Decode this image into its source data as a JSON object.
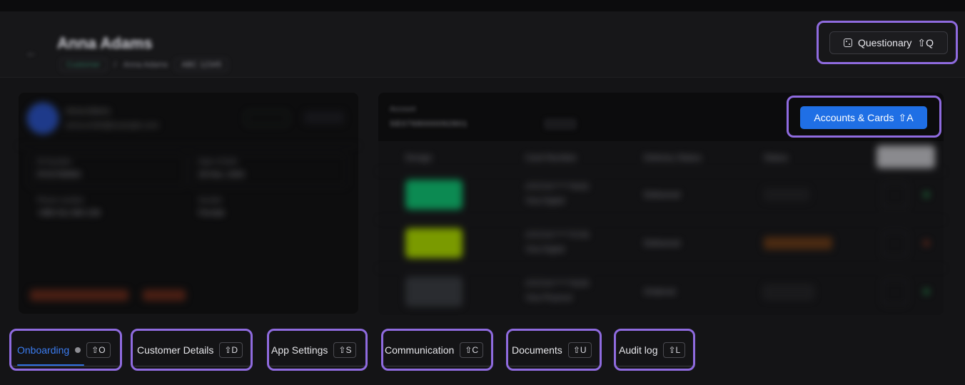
{
  "header": {
    "back_icon": "arrow-left-icon",
    "customer_name": "Anna Adams",
    "breadcrumb": {
      "status": "Customer",
      "separator": "/",
      "name": "Anna Adams",
      "id_chip": "ABC 12345"
    },
    "questionary_button": {
      "icon": "dice-icon",
      "label": "Questionary",
      "shortcut": "⇧Q"
    }
  },
  "profile": {
    "name": "Anna Adams",
    "email": "anna.smith@example.com",
    "fields": [
      {
        "label": "ID Number",
        "value": "8702780894"
      },
      {
        "label": "Date of birth",
        "value": "28 Nov, 2000"
      },
      {
        "label": "Phone number",
        "value": "+886 911 884 238"
      },
      {
        "label": "Gender",
        "value": "Female"
      }
    ]
  },
  "accounts": {
    "account_label": "Account",
    "account_number": "SE0768000092801",
    "accounts_cards_button": {
      "label": "Accounts & Cards",
      "shortcut": "⇧A"
    },
    "table": {
      "headers": [
        "Design",
        "Card Number",
        "Delivery Status",
        "Status"
      ],
      "rows": [
        {
          "design_color": "#0c8a52",
          "card_number": "4707XX******6032",
          "card_type": "Visa Digital",
          "delivery": "Delivered",
          "status_color": "#1a1a1c",
          "dot_color": "#1d6a3a"
        },
        {
          "design_color": "#7a9a00",
          "card_number": "4707XX******5735",
          "card_type": "Visa Digital",
          "delivery": "Delivered",
          "status_color": "#4a2a12",
          "dot_color": "#6b2a1a"
        },
        {
          "design_color": "#2a2c30",
          "card_number": "4707XX******6035",
          "card_type": "Visa Physical",
          "delivery": "Ordered",
          "status_color": "#1a1a1c",
          "dot_color": "#1d6a3a"
        }
      ]
    }
  },
  "tabs": [
    {
      "label": "Onboarding",
      "shortcut": "⇧O",
      "active": true
    },
    {
      "label": "Customer Details",
      "shortcut": "⇧D",
      "active": false
    },
    {
      "label": "App Settings",
      "shortcut": "⇧S",
      "active": false
    },
    {
      "label": "Communication",
      "shortcut": "⇧C",
      "active": false
    },
    {
      "label": "Documents",
      "shortcut": "⇧U",
      "active": false
    },
    {
      "label": "Audit log",
      "shortcut": "⇧L",
      "active": false
    }
  ]
}
